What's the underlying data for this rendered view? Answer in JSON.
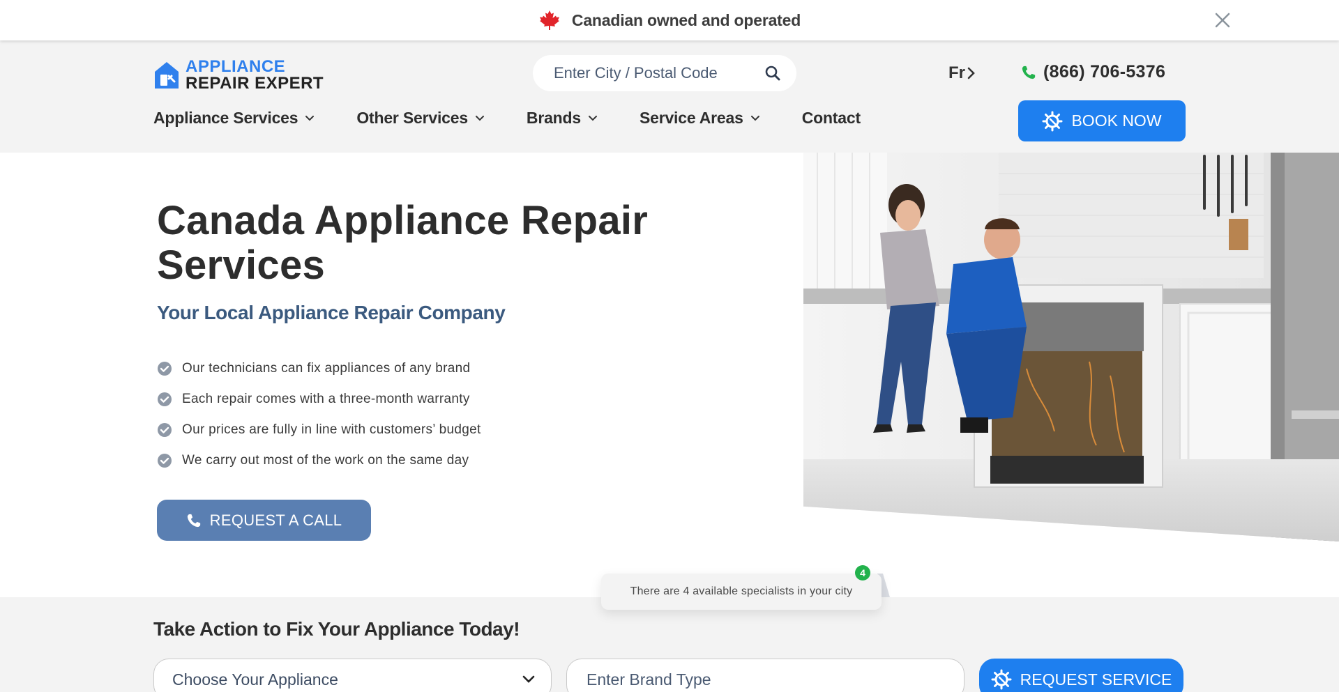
{
  "banner": {
    "text": "Canadian owned and operated",
    "flag_icon": "maple-leaf-icon",
    "close_icon": "close-icon",
    "flag_color": "#e1242a"
  },
  "header": {
    "logo": {
      "line1": "APPLIANCE",
      "line2": "REPAIR EXPERT",
      "brand_color": "#2f80ed"
    },
    "search": {
      "placeholder": "Enter City / Postal Code",
      "icon": "search-icon"
    },
    "language": {
      "label": "Fr"
    },
    "phone": {
      "number": "(866) 706-5376",
      "icon": "phone-icon",
      "icon_color": "#22b24c"
    },
    "nav": [
      {
        "label": "Appliance Services",
        "has_dropdown": true
      },
      {
        "label": "Other Services",
        "has_dropdown": true
      },
      {
        "label": "Brands",
        "has_dropdown": true
      },
      {
        "label": "Service Areas",
        "has_dropdown": true
      },
      {
        "label": "Contact",
        "has_dropdown": false
      }
    ],
    "book_now": {
      "label": "BOOK NOW",
      "icon": "gear-wrench-icon",
      "color": "#1e7fef"
    }
  },
  "hero": {
    "title": "Canada Appliance Repair Services",
    "subtitle": "Your Local Appliance Repair Company",
    "features": [
      "Our technicians can fix appliances of any brand",
      "Each repair comes with a three-month warranty",
      "Our prices are fully in line with customers’ budget",
      "We carry out most of the work on the same day"
    ],
    "request_call": {
      "label": "REQUEST A CALL",
      "icon": "phone-icon",
      "color": "#5a7fb2"
    },
    "image": "technician-repairing-dishwasher-photo"
  },
  "specialists": {
    "text": "There are 4 available specialists in your city",
    "badge": "4"
  },
  "action": {
    "title": "Take Action to Fix Your Appliance Today!",
    "appliance_select": {
      "label": "Choose Your Appliance"
    },
    "brand_input": {
      "placeholder": "Enter Brand Type"
    },
    "request_service": {
      "label": "REQUEST SERVICE",
      "icon": "gear-wrench-icon"
    }
  }
}
